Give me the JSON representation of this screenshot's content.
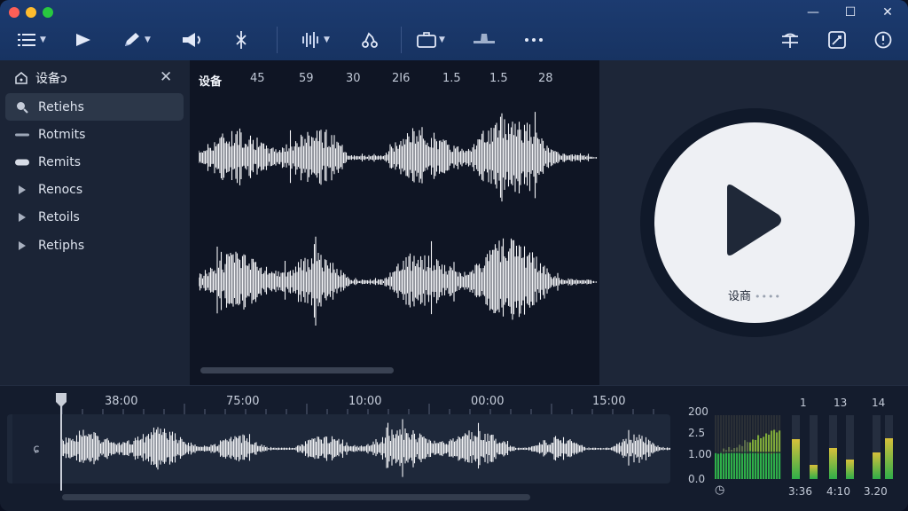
{
  "window": {
    "controls": {
      "minimize": "—",
      "maximize": "☐",
      "close": "✕"
    }
  },
  "toolbar": {
    "tools": [
      {
        "name": "list-icon",
        "has_menu": true
      },
      {
        "name": "play-icon",
        "has_menu": false
      },
      {
        "name": "pencil-icon",
        "has_menu": true
      },
      {
        "name": "speaker-icon",
        "has_menu": false
      },
      {
        "name": "cut-icon",
        "has_menu": false
      },
      {
        "name": "waveform-icon",
        "has_menu": true
      },
      {
        "name": "share-icon",
        "has_menu": false
      },
      {
        "name": "briefcase-icon",
        "has_menu": true
      },
      {
        "name": "stand-icon",
        "has_menu": false
      },
      {
        "name": "more-icon",
        "has_menu": false
      }
    ],
    "right_tools": [
      {
        "name": "trim-icon"
      },
      {
        "name": "image-edit-icon"
      },
      {
        "name": "info-icon"
      }
    ]
  },
  "sidebar": {
    "title": "设备ɔ",
    "close": "✕",
    "items": [
      {
        "label": "Retiehs",
        "icon": "search-icon",
        "active": true
      },
      {
        "label": "Rotmits",
        "icon": "dash-icon",
        "active": false
      },
      {
        "label": "Remits",
        "icon": "pill-icon",
        "active": false
      },
      {
        "label": "Renocs",
        "icon": "triangle-right-icon",
        "active": false
      },
      {
        "label": "Retoils",
        "icon": "triangle-right-icon",
        "active": false
      },
      {
        "label": "Retiphs",
        "icon": "triangle-right-icon",
        "active": false
      }
    ]
  },
  "waveform": {
    "ruler": [
      "设备",
      "45",
      "59",
      "30",
      "2I6",
      "1.5",
      "1.5",
      "28"
    ]
  },
  "player": {
    "caption": "设商",
    "dots": "••••"
  },
  "timeline": {
    "labels": [
      "38:00",
      "75:00",
      "10:00",
      "00:00",
      "15:00"
    ],
    "track_icon": "ɕ"
  },
  "meters": {
    "y_labels": [
      "200",
      "2.5",
      "1.00",
      "0.0"
    ],
    "col_labels": [
      "1",
      "13",
      "14"
    ],
    "bottom_labels": [
      "3:36",
      "4:10",
      "3.20"
    ],
    "clock": "◷",
    "levels": [
      0.62,
      0.22,
      0.48,
      0.3
    ]
  },
  "colors": {
    "accent": "#1c3b70",
    "meter_green": "#2fae49",
    "meter_yellow": "#d7c03a",
    "waveform": "#f3f4f7"
  }
}
